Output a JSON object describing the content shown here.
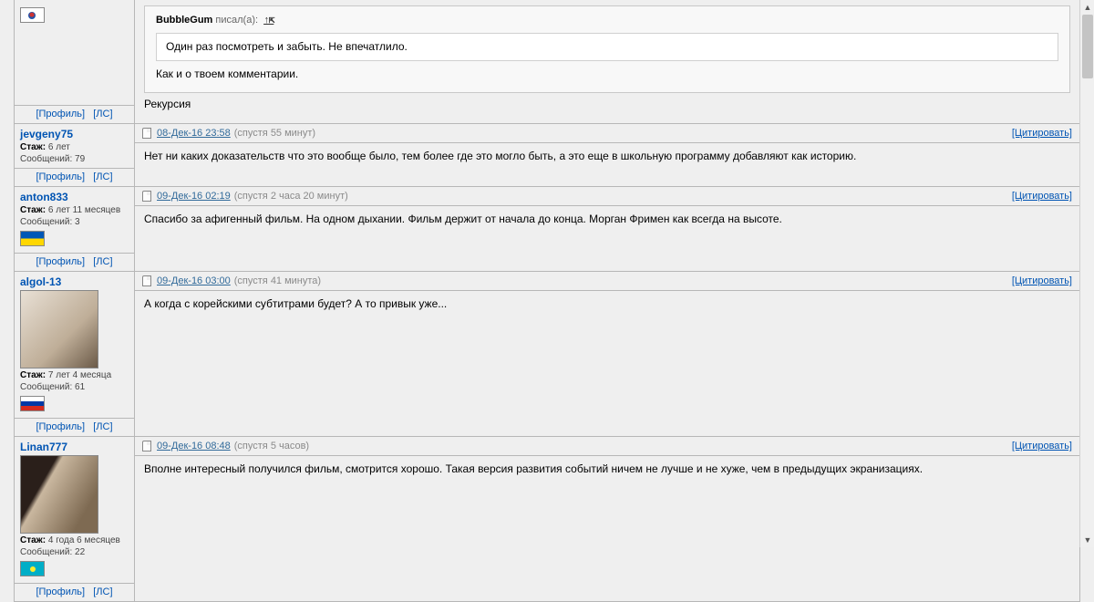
{
  "labels": {
    "profile": "[Профиль]",
    "pm": "[ЛС]",
    "quote": "[Цитировать]",
    "stazh": "Стаж:",
    "msgs": "Сообщений:",
    "wrote": "писал(а):",
    "jump": "↑⇱"
  },
  "posts": [
    {
      "user": {
        "name": "",
        "stazh": "",
        "msgs": "",
        "flag": "flag-kr",
        "avatar": ""
      },
      "head": {
        "date": "",
        "since": ""
      },
      "quote": {
        "author": "BubbleGum",
        "inner": "Один раз посмотреть и забыть. Не впечатлило.",
        "after_inner": "Как и о твоем комментарии."
      },
      "body_after": "Рекурсия",
      "show_head": false,
      "show_user_core": false
    },
    {
      "user": {
        "name": "jevgeny75",
        "stazh": "6 лет",
        "msgs": "79",
        "flag": "",
        "avatar": ""
      },
      "head": {
        "date": "08-Дек-16 23:58",
        "since": "(спустя 55 минут)"
      },
      "body": "Нет ни каких доказательств что это вообще было, тем более где это могло быть, а это еще в школьную программу добавляют как историю.",
      "show_head": true,
      "show_user_core": true
    },
    {
      "user": {
        "name": "anton833",
        "stazh": "6 лет 11 месяцев",
        "msgs": "3",
        "flag": "flag-ua",
        "avatar": ""
      },
      "head": {
        "date": "09-Дек-16 02:19",
        "since": "(спустя 2 часа 20 минут)"
      },
      "body": "Спасибо за афигенный фильм. На одном дыхании. Фильм держит от начала до конца. Морган Фримен как всегда на высоте.",
      "show_head": true,
      "show_user_core": true
    },
    {
      "user": {
        "name": "algol-13",
        "stazh": "7 лет 4 месяца",
        "msgs": "61",
        "flag": "flag-ru",
        "avatar": "avatar-cat"
      },
      "head": {
        "date": "09-Дек-16 03:00",
        "since": "(спустя 41 минута)"
      },
      "body": "А когда с корейскими субтитрами будет? А то привык уже...",
      "show_head": true,
      "show_user_core": true
    },
    {
      "user": {
        "name": "Linan777",
        "stazh": "4 года 6 месяцев",
        "msgs": "22",
        "flag": "flag-kz",
        "avatar": "avatar-girl"
      },
      "head": {
        "date": "09-Дек-16 08:48",
        "since": "(спустя 5 часов)"
      },
      "body": "Вполне интересный получился фильм, смотрится хорошо. Такая версия развития событий ничем не лучше и не хуже, чем в предыдущих экранизациях.",
      "show_head": true,
      "show_user_core": true
    }
  ]
}
